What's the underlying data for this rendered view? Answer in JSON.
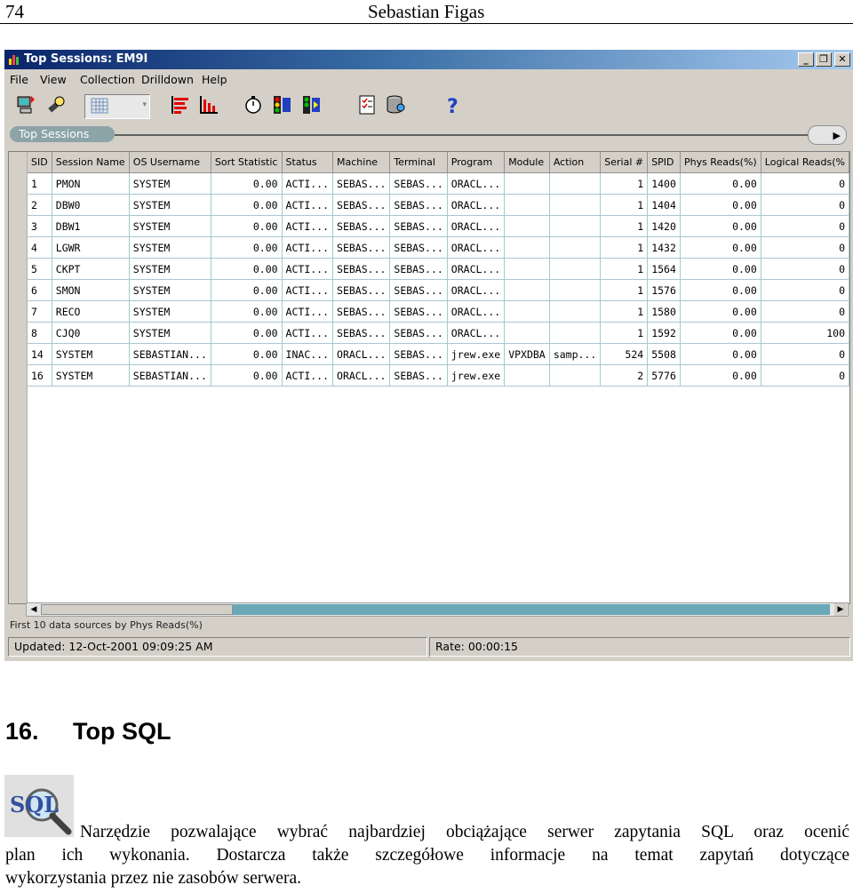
{
  "header": {
    "page_number": "74",
    "author": "Sebastian Figas"
  },
  "window": {
    "title": "Top Sessions: EM9I",
    "menu": [
      "File",
      "View",
      "Collection",
      "Drilldown",
      "Help"
    ],
    "tab_label": "Top Sessions",
    "columns": [
      "SID",
      "Session Name",
      "OS Username",
      "Sort Statistic",
      "Status",
      "Machine",
      "Terminal",
      "Program",
      "Module",
      "Action",
      "Serial #",
      "SPID",
      "Phys Reads(%)",
      "Logical Reads(%"
    ],
    "rows": [
      [
        "1",
        "PMON",
        "SYSTEM",
        "0.00",
        "ACTI...",
        "SEBAS...",
        "SEBAS...",
        "ORACL...",
        "",
        "",
        "1",
        "1400",
        "0.00",
        "0"
      ],
      [
        "2",
        "DBW0",
        "SYSTEM",
        "0.00",
        "ACTI...",
        "SEBAS...",
        "SEBAS...",
        "ORACL...",
        "",
        "",
        "1",
        "1404",
        "0.00",
        "0"
      ],
      [
        "3",
        "DBW1",
        "SYSTEM",
        "0.00",
        "ACTI...",
        "SEBAS...",
        "SEBAS...",
        "ORACL...",
        "",
        "",
        "1",
        "1420",
        "0.00",
        "0"
      ],
      [
        "4",
        "LGWR",
        "SYSTEM",
        "0.00",
        "ACTI...",
        "SEBAS...",
        "SEBAS...",
        "ORACL...",
        "",
        "",
        "1",
        "1432",
        "0.00",
        "0"
      ],
      [
        "5",
        "CKPT",
        "SYSTEM",
        "0.00",
        "ACTI...",
        "SEBAS...",
        "SEBAS...",
        "ORACL...",
        "",
        "",
        "1",
        "1564",
        "0.00",
        "0"
      ],
      [
        "6",
        "SMON",
        "SYSTEM",
        "0.00",
        "ACTI...",
        "SEBAS...",
        "SEBAS...",
        "ORACL...",
        "",
        "",
        "1",
        "1576",
        "0.00",
        "0"
      ],
      [
        "7",
        "RECO",
        "SYSTEM",
        "0.00",
        "ACTI...",
        "SEBAS...",
        "SEBAS...",
        "ORACL...",
        "",
        "",
        "1",
        "1580",
        "0.00",
        "0"
      ],
      [
        "8",
        "CJQ0",
        "SYSTEM",
        "0.00",
        "ACTI...",
        "SEBAS...",
        "SEBAS...",
        "ORACL...",
        "",
        "",
        "1",
        "1592",
        "0.00",
        "100"
      ],
      [
        "14",
        "SYSTEM",
        "SEBASTIAN...",
        "0.00",
        "INAC...",
        "ORACL...",
        "SEBAS...",
        "jrew.exe",
        "VPXDBA",
        "samp...",
        "524",
        "5508",
        "0.00",
        "0"
      ],
      [
        "16",
        "SYSTEM",
        "SEBASTIAN...",
        "0.00",
        "ACTI...",
        "ORACL...",
        "SEBAS...",
        "jrew.exe",
        "",
        "",
        "2",
        "5776",
        "0.00",
        "0"
      ]
    ],
    "footnote": "First 10 data sources by Phys Reads(%)",
    "status_updated": "Updated: 12-Oct-2001 09:09:25 AM",
    "status_rate": "Rate: 00:00:15"
  },
  "section": {
    "number": "16.",
    "title": "Top SQL",
    "icon_label": "SQL",
    "line1": "Narzędzie pozwalające wybrać najbardziej obciążające serwer zapytania SQL oraz ocenić",
    "line2": "plan ich wykonania. Dostarcza także szczegółowe informacje na temat zapytań dotyczące",
    "line3": "wykorzystania przez nie zasobów serwera."
  }
}
